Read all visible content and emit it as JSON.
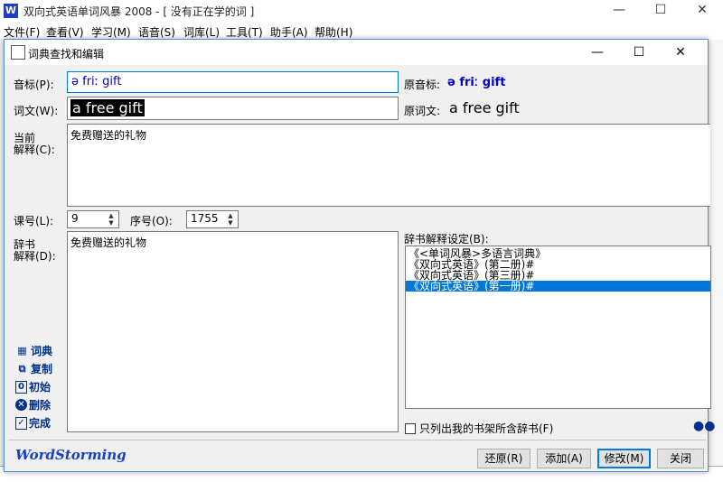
{
  "main_window": {
    "title": "双向式英语单词风暴 2008 - [ 没有正在学的词 ]",
    "icon_letter": "W",
    "menu": [
      "文件(F)",
      "查看(V)",
      "学习(M)",
      "语音(S)",
      "词库(L)",
      "工具(T)",
      "助手(A)",
      "帮助(H)"
    ]
  },
  "dialog": {
    "title": "词典查找和编辑",
    "phonetic_label": "音标(P):",
    "phonetic_value": "ə friː gift",
    "orig_phonetic_label": "原音标:",
    "orig_phonetic_value": "ə friː gift",
    "word_label": "词文(W):",
    "word_value": "a free gift",
    "orig_word_label": "原词文:",
    "orig_word_value": "a free gift",
    "current_def_label_1": "当前",
    "current_def_label_2": "解释(C):",
    "current_def_value": "免费赠送的礼物",
    "lesson_label": "课号(L):",
    "lesson_value": "9",
    "seq_label": "序号(O):",
    "seq_value": "1755",
    "dict_def_label_1": "辞书",
    "dict_def_label_2": "解释(D):",
    "dict_def_value": "免费赠送的礼物",
    "dict_setting_label": "辞书解释设定(B):",
    "dict_list": [
      "《<单词风暴>多语言词典》",
      "《双向式英语》(第二册)#",
      "《双向式英语》(第三册)#",
      "《双向式英语》(第一册)#"
    ],
    "dict_list_selected": 3,
    "side_buttons": [
      {
        "label": "词典",
        "icon": "dictionary-icon"
      },
      {
        "label": "复制",
        "icon": "copy-icon"
      },
      {
        "label": "初始",
        "icon": "reset-icon"
      },
      {
        "label": "删除",
        "icon": "delete-icon"
      },
      {
        "label": "完成",
        "icon": "done-icon"
      }
    ],
    "checkbox_label": "只列出我的书架所含辞书(F)",
    "brand": "WordStorming",
    "buttons": {
      "restore": "还原(R)",
      "add": "添加(A)",
      "modify": "修改(M)",
      "close": "关闭"
    }
  }
}
